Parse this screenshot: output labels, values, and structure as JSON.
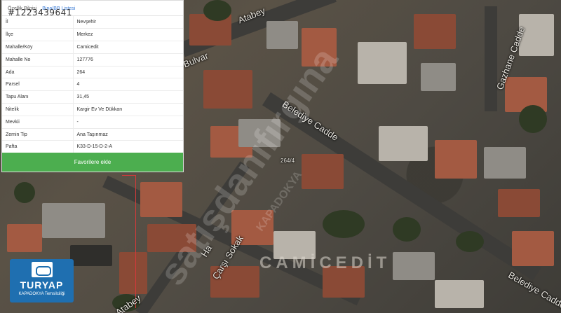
{
  "map": {
    "streets": {
      "bulvar": "Bulvar",
      "atabey_top": "Atabey",
      "belediye_1": "Belediye Cadde",
      "belediye_2": "Belediye Cadde",
      "gazhane": "Gazhane Cadde",
      "carsi": "Çarşı Sokak",
      "atabey_bottom": "Atabey",
      "h": "Ha"
    },
    "district": "CAMİCEDİT",
    "parcel_marker": "264/4",
    "watermark": "satışdanıfırgına",
    "watermark_sub": "KAPADOKYA"
  },
  "panel": {
    "listing_no": "#1223439641",
    "tabs": [
      {
        "label": "Özellik Bilgisi",
        "active": true
      },
      {
        "label": "Bina/BB Listesi",
        "active": false
      }
    ],
    "rows": [
      {
        "key": "İl",
        "value": "Nevşehir"
      },
      {
        "key": "İlçe",
        "value": "Merkez"
      },
      {
        "key": "Mahalle/Köy",
        "value": "Camicedit"
      },
      {
        "key": "Mahalle No",
        "value": "127776"
      },
      {
        "key": "Ada",
        "value": "264"
      },
      {
        "key": "Parsel",
        "value": "4"
      },
      {
        "key": "Tapu Alanı",
        "value": "31,45"
      },
      {
        "key": "Nitelik",
        "value": "Kargir Ev Ve Dükkan"
      },
      {
        "key": "Mevkii",
        "value": "-"
      },
      {
        "key": "Zemin Tip",
        "value": "Ana Taşınmaz"
      },
      {
        "key": "Pafta",
        "value": "K33-D-15-D-2-A"
      }
    ],
    "favorite_button": "Favorilere ekle"
  },
  "logo": {
    "name": "TURYAP",
    "subtitle": "KAPADOKYA Temsilciliği"
  },
  "colors": {
    "accent_green": "#4cae4f",
    "link_blue": "#3a7bd5",
    "logo_blue": "#1f6fb0",
    "parcel_red": "#d23a3a"
  }
}
